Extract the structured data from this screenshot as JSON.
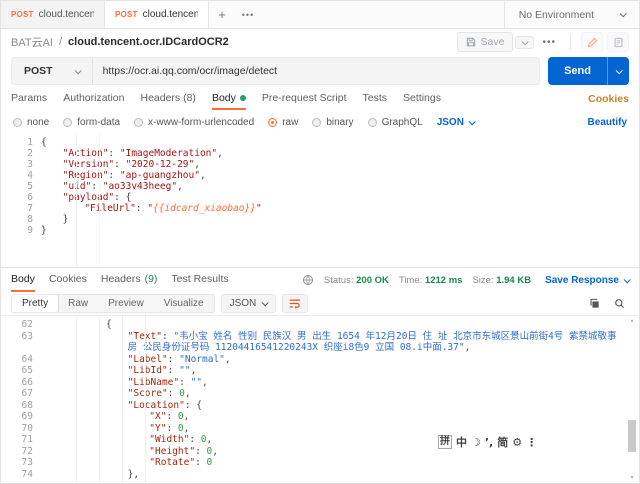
{
  "colors": {
    "accent_orange": "#ff6c37",
    "link_blue": "#0265d2",
    "success_green": "#1b8a4c",
    "string_red": "#a31515",
    "key_maroon": "#a1260d",
    "value_blue": "#2f6ccb",
    "number_green": "#2f9e44"
  },
  "tabbar": {
    "tabs": [
      {
        "method": "POST",
        "title": "cloud.tencent.ocr.IDCa"
      },
      {
        "method": "POST",
        "title": "cloud.tencent.ocr.IDCa"
      }
    ],
    "new_tab_label": "+",
    "more_label": "•••",
    "environment": "No Environment"
  },
  "header": {
    "collection": "BAT云AI",
    "separator": "/",
    "request_name": "cloud.tencent.ocr.IDCardOCR2",
    "save_label": "Save",
    "more_label": "•••"
  },
  "request": {
    "method": "POST",
    "url": "https://ocr.ai.qq.com/ocr/image/detect",
    "send_label": "Send",
    "tabs": [
      "Params",
      "Authorization",
      "Headers (8)",
      "Body",
      "Pre-request Script",
      "Tests",
      "Settings"
    ],
    "cookies_link": "Cookies",
    "modes": [
      "none",
      "form-data",
      "x-www-form-urlencoded",
      "raw",
      "binary",
      "GraphQL"
    ],
    "selected_mode": "raw",
    "format": "JSON",
    "beautify_link": "Beautify",
    "editor_lines": [
      {
        "n": "1",
        "ind": 0,
        "t": [
          [
            "p",
            "{"
          ]
        ]
      },
      {
        "n": "2",
        "ind": 4,
        "t": [
          [
            "s",
            "\"Action\""
          ],
          [
            "p",
            ": "
          ],
          [
            "s",
            "\"ImageModeration\""
          ],
          [
            "p",
            ","
          ]
        ]
      },
      {
        "n": "3",
        "ind": 4,
        "t": [
          [
            "s",
            "\"Version\""
          ],
          [
            "p",
            ": "
          ],
          [
            "s",
            "\"2020-12-29\""
          ],
          [
            "p",
            ","
          ]
        ]
      },
      {
        "n": "4",
        "ind": 4,
        "t": [
          [
            "s",
            "\"Region\""
          ],
          [
            "p",
            ": "
          ],
          [
            "s",
            "\"ap-guangzhou\""
          ],
          [
            "p",
            ","
          ]
        ]
      },
      {
        "n": "5",
        "ind": 4,
        "t": [
          [
            "s",
            "\"uid\""
          ],
          [
            "p",
            ": "
          ],
          [
            "s",
            "\"ao33v43heeg\""
          ],
          [
            "p",
            ","
          ]
        ]
      },
      {
        "n": "6",
        "ind": 4,
        "t": [
          [
            "s",
            "\"payload\""
          ],
          [
            "p",
            ": {"
          ]
        ]
      },
      {
        "n": "7",
        "ind": 8,
        "t": [
          [
            "s",
            "\"FileUrl\""
          ],
          [
            "p",
            ": "
          ],
          [
            "s",
            "\""
          ],
          [
            "t",
            "{{idcard_xiaobao}}"
          ],
          [
            "s",
            "\""
          ]
        ]
      },
      {
        "n": "8",
        "ind": 4,
        "t": [
          [
            "p",
            "}"
          ]
        ]
      },
      {
        "n": "9",
        "ind": 0,
        "t": [
          [
            "p",
            "}"
          ]
        ]
      }
    ]
  },
  "response": {
    "tabs": {
      "body": "Body",
      "cookies": "Cookies",
      "headers": "Headers",
      "headers_count": "(9)",
      "tests": "Test Results"
    },
    "meta": {
      "status_label": "Status:",
      "status_value": "200 OK",
      "time_label": "Time:",
      "time_value": "1212 ms",
      "size_label": "Size:",
      "size_value": "1.94 KB",
      "save_response_label": "Save Response"
    },
    "views": [
      "Pretty",
      "Raw",
      "Preview",
      "Visualize"
    ],
    "format": "JSON",
    "viewer_lines": [
      {
        "n": "62",
        "ind": 12,
        "t": [
          [
            "p",
            "{"
          ]
        ]
      },
      {
        "n": "63",
        "ind": 16,
        "t": [
          [
            "k",
            "\"Text\""
          ],
          [
            "p",
            ": "
          ],
          [
            "v",
            "\"韦小宝 姓名 性别 民族汉 男 出生 1654 年12月20日 住 址 北京市东城区景山前街4号 紫禁城敬事房 公民身份证号码 11204416541220243X 织座i8色9 立国 08.i中面.37\""
          ],
          [
            "p",
            ","
          ]
        ]
      },
      {
        "n": "64",
        "ind": 16,
        "t": [
          [
            "k",
            "\"Label\""
          ],
          [
            "p",
            ": "
          ],
          [
            "v",
            "\"Normal\""
          ],
          [
            "p",
            ","
          ]
        ]
      },
      {
        "n": "65",
        "ind": 16,
        "t": [
          [
            "k",
            "\"LibId\""
          ],
          [
            "p",
            ": "
          ],
          [
            "v",
            "\"\""
          ],
          [
            "p",
            ","
          ]
        ]
      },
      {
        "n": "66",
        "ind": 16,
        "t": [
          [
            "k",
            "\"LibName\""
          ],
          [
            "p",
            ": "
          ],
          [
            "v",
            "\"\""
          ],
          [
            "p",
            ","
          ]
        ]
      },
      {
        "n": "67",
        "ind": 16,
        "t": [
          [
            "k",
            "\"Score\""
          ],
          [
            "p",
            ": "
          ],
          [
            "n",
            "0"
          ],
          [
            "p",
            ","
          ]
        ]
      },
      {
        "n": "68",
        "ind": 16,
        "t": [
          [
            "k",
            "\"Location\""
          ],
          [
            "p",
            ": {"
          ]
        ]
      },
      {
        "n": "69",
        "ind": 20,
        "t": [
          [
            "k",
            "\"X\""
          ],
          [
            "p",
            ": "
          ],
          [
            "n",
            "0"
          ],
          [
            "p",
            ","
          ]
        ]
      },
      {
        "n": "70",
        "ind": 20,
        "t": [
          [
            "k",
            "\"Y\""
          ],
          [
            "p",
            ": "
          ],
          [
            "n",
            "0"
          ],
          [
            "p",
            ","
          ]
        ]
      },
      {
        "n": "71",
        "ind": 20,
        "t": [
          [
            "k",
            "\"Width\""
          ],
          [
            "p",
            ": "
          ],
          [
            "n",
            "0"
          ],
          [
            "p",
            ","
          ]
        ]
      },
      {
        "n": "72",
        "ind": 20,
        "t": [
          [
            "k",
            "\"Height\""
          ],
          [
            "p",
            ": "
          ],
          [
            "n",
            "0"
          ],
          [
            "p",
            ","
          ]
        ]
      },
      {
        "n": "73",
        "ind": 20,
        "t": [
          [
            "k",
            "\"Rotate\""
          ],
          [
            "p",
            ": "
          ],
          [
            "n",
            "0"
          ]
        ]
      },
      {
        "n": "74",
        "ind": 16,
        "t": [
          [
            "p",
            "},"
          ]
        ]
      }
    ]
  },
  "ime_toolbar": {
    "items": [
      "拼",
      "中",
      "☽",
      "’,",
      "简",
      "⚙",
      "⋮"
    ]
  }
}
